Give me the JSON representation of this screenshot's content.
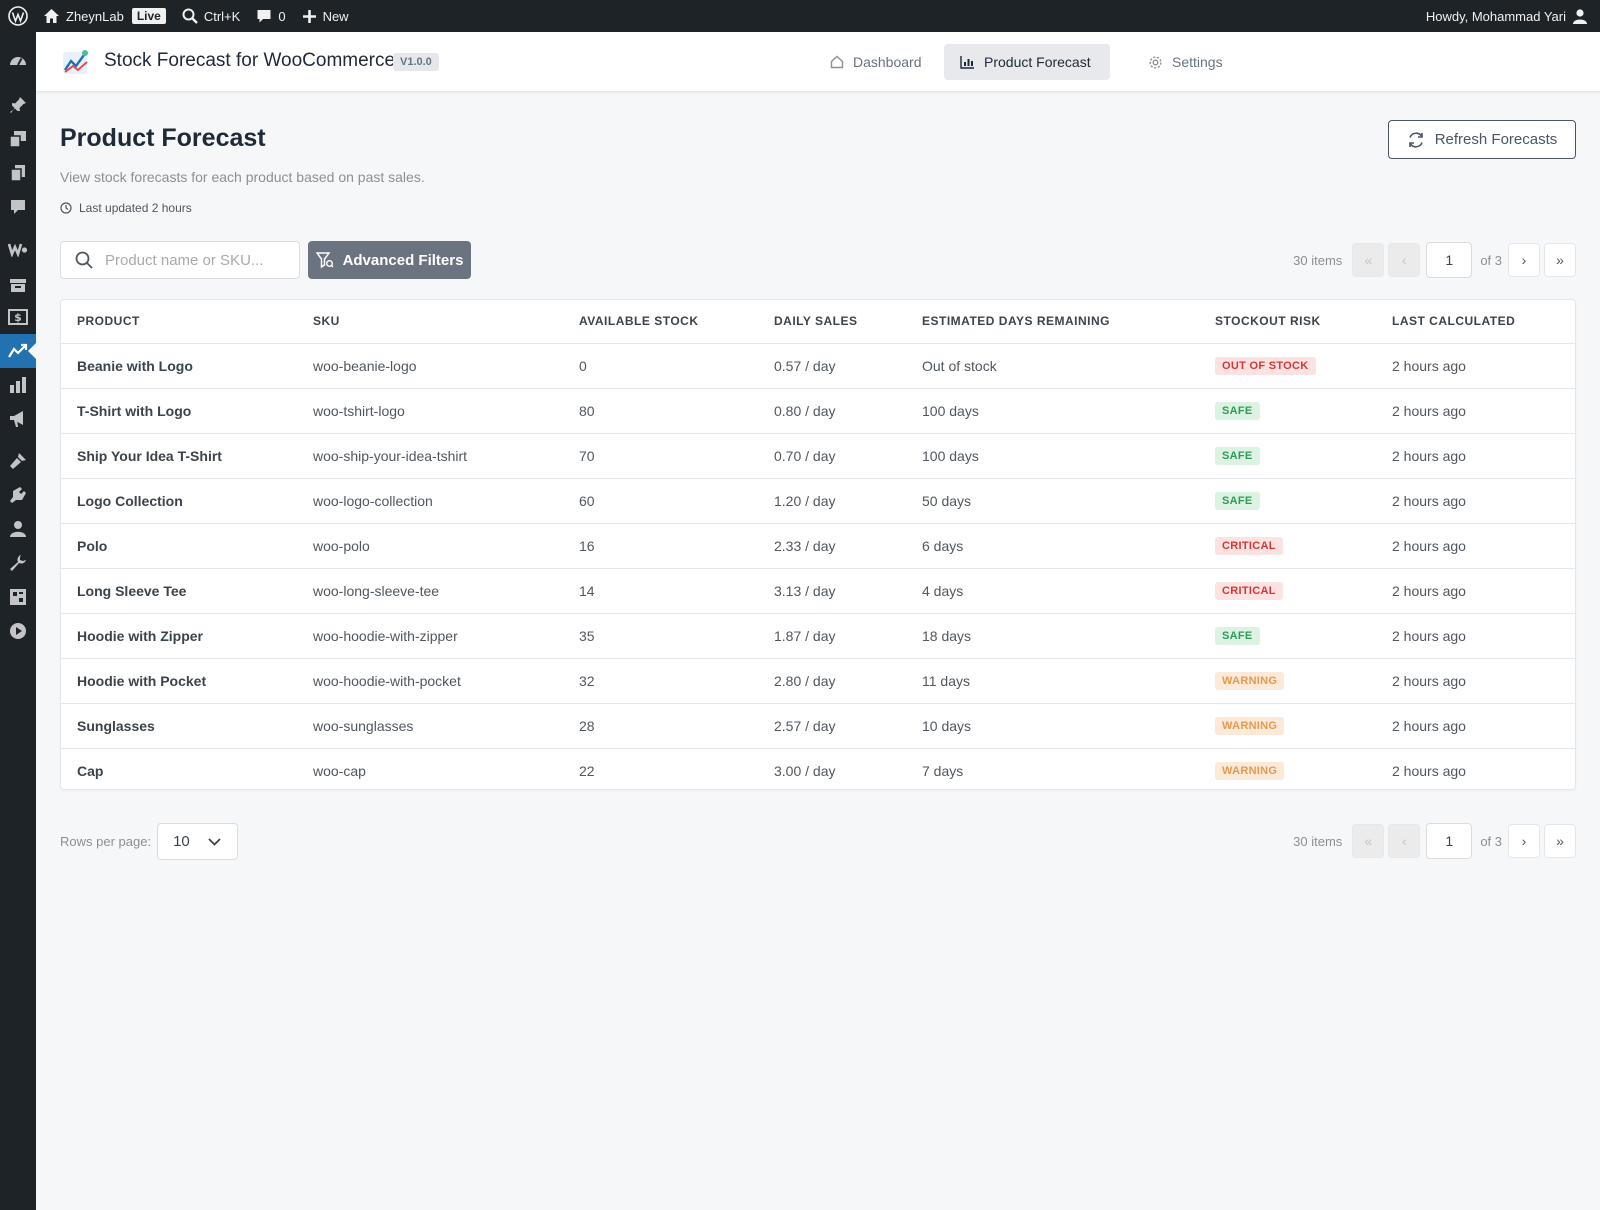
{
  "adminbar": {
    "site_name": "ZheynLab",
    "live_badge": "Live",
    "search_shortcut": "Ctrl+K",
    "comments_count": "0",
    "new_label": "New",
    "greeting": "Howdy, Mohammad Yari"
  },
  "admin_menu": {
    "icons": [
      "dashboard-icon",
      "pin-icon",
      "media-icon",
      "pages-icon",
      "comments-icon",
      "woocommerce-icon",
      "products-icon",
      "payments-icon",
      "stock-forecast-icon",
      "analytics-icon",
      "marketing-icon",
      "appearance-icon",
      "plugins-icon",
      "users-icon",
      "tools-icon",
      "settings-icon",
      "media-player-icon"
    ],
    "active": "stock-forecast-icon"
  },
  "plugin": {
    "title": "Stock Forecast for WooCommerce",
    "version": "V1.0.0",
    "tabs": [
      {
        "label": "Dashboard",
        "icon": "home-icon",
        "active": false
      },
      {
        "label": "Product Forecast",
        "icon": "chart-icon",
        "active": true
      },
      {
        "label": "Settings",
        "icon": "gear-icon",
        "active": false
      }
    ]
  },
  "page": {
    "title": "Product Forecast",
    "description": "View stock forecasts for each product based on past sales.",
    "last_updated": "Last updated 2 hours",
    "refresh_label": "Refresh Forecasts"
  },
  "toolbar": {
    "search_placeholder": "Product name or SKU...",
    "search_value": "",
    "filters_label": "Advanced Filters"
  },
  "pagination": {
    "items_label": "30 items",
    "first": "«",
    "prev": "‹",
    "current_page": "1",
    "of_label": "of 3",
    "next": "›",
    "last": "»"
  },
  "table": {
    "columns": [
      "PRODUCT",
      "SKU",
      "AVAILABLE STOCK",
      "DAILY SALES",
      "ESTIMATED DAYS REMAINING",
      "STOCKOUT RISK",
      "LAST CALCULATED"
    ],
    "rows": [
      {
        "product": "Beanie with Logo",
        "sku": "woo-beanie-logo",
        "stock": "0",
        "daily": "0.57 / day",
        "days": "Out of stock",
        "risk": "OUT OF STOCK",
        "risk_type": "out",
        "calc": "2 hours ago"
      },
      {
        "product": "T-Shirt with Logo",
        "sku": "woo-tshirt-logo",
        "stock": "80",
        "daily": "0.80 / day",
        "days": "100 days",
        "risk": "SAFE",
        "risk_type": "safe",
        "calc": "2 hours ago"
      },
      {
        "product": "Ship Your Idea T-Shirt",
        "sku": "woo-ship-your-idea-tshirt",
        "stock": "70",
        "daily": "0.70 / day",
        "days": "100 days",
        "risk": "SAFE",
        "risk_type": "safe",
        "calc": "2 hours ago"
      },
      {
        "product": "Logo Collection",
        "sku": "woo-logo-collection",
        "stock": "60",
        "daily": "1.20 / day",
        "days": "50 days",
        "risk": "SAFE",
        "risk_type": "safe",
        "calc": "2 hours ago"
      },
      {
        "product": "Polo",
        "sku": "woo-polo",
        "stock": "16",
        "daily": "2.33 / day",
        "days": "6 days",
        "risk": "CRITICAL",
        "risk_type": "critical",
        "calc": "2 hours ago"
      },
      {
        "product": "Long Sleeve Tee",
        "sku": "woo-long-sleeve-tee",
        "stock": "14",
        "daily": "3.13 / day",
        "days": "4 days",
        "risk": "CRITICAL",
        "risk_type": "critical",
        "calc": "2 hours ago"
      },
      {
        "product": "Hoodie with Zipper",
        "sku": "woo-hoodie-with-zipper",
        "stock": "35",
        "daily": "1.87 / day",
        "days": "18 days",
        "risk": "SAFE",
        "risk_type": "safe",
        "calc": "2 hours ago"
      },
      {
        "product": "Hoodie with Pocket",
        "sku": "woo-hoodie-with-pocket",
        "stock": "32",
        "daily": "2.80 / day",
        "days": "11 days",
        "risk": "WARNING",
        "risk_type": "warning",
        "calc": "2 hours ago"
      },
      {
        "product": "Sunglasses",
        "sku": "woo-sunglasses",
        "stock": "28",
        "daily": "2.57 / day",
        "days": "10 days",
        "risk": "WARNING",
        "risk_type": "warning",
        "calc": "2 hours ago"
      },
      {
        "product": "Cap",
        "sku": "woo-cap",
        "stock": "22",
        "daily": "3.00 / day",
        "days": "7 days",
        "risk": "WARNING",
        "risk_type": "warning",
        "calc": "2 hours ago"
      }
    ]
  },
  "footer": {
    "rows_per_page_label": "Rows per page:",
    "rows_per_page_value": "10"
  },
  "colors": {
    "admin_dark": "#1d2327",
    "accent_blue": "#2271b1",
    "safe": "#2e9b57",
    "critical": "#d63638",
    "warning": "#e59a4f",
    "filter_button": "#6b7280"
  }
}
